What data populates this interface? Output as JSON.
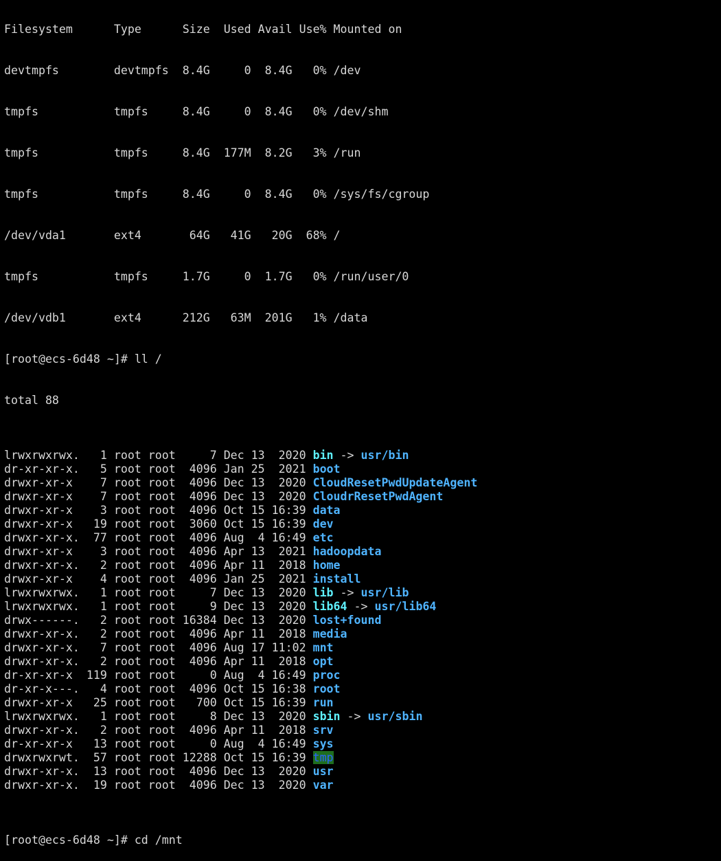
{
  "terminal": {
    "df_header": "Filesystem      Type      Size  Used Avail Use% Mounted on",
    "df_rows": [
      "devtmpfs        devtmpfs  8.4G     0  8.4G   0% /dev",
      "tmpfs           tmpfs     8.4G     0  8.4G   0% /dev/shm",
      "tmpfs           tmpfs     8.4G  177M  8.2G   3% /run",
      "tmpfs           tmpfs     8.4G     0  8.4G   0% /sys/fs/cgroup",
      "/dev/vda1       ext4       64G   41G   20G  68% /",
      "tmpfs           tmpfs     1.7G     0  1.7G   0% /run/user/0",
      "/dev/vdb1       ext4      212G   63M  201G   1% /data"
    ],
    "prompt_ll": "[root@ecs-6d48 ~]# ll /",
    "total": "total 88",
    "ls_rows": [
      {
        "prefix": "lrwxrwxrwx.   1 root root     7 Dec 13  2020 ",
        "name": "bin",
        "arrow": " -> ",
        "target": "usr/bin"
      },
      {
        "prefix": "dr-xr-xr-x.   5 root root  4096 Jan 25  2021 ",
        "name": "boot"
      },
      {
        "prefix": "drwxr-xr-x    7 root root  4096 Dec 13  2020 ",
        "name": "CloudResetPwdUpdateAgent"
      },
      {
        "prefix": "drwxr-xr-x    7 root root  4096 Dec 13  2020 ",
        "name": "CloudrResetPwdAgent"
      },
      {
        "prefix": "drwxr-xr-x    3 root root  4096 Oct 15 16:39 ",
        "name": "data"
      },
      {
        "prefix": "drwxr-xr-x   19 root root  3060 Oct 15 16:39 ",
        "name": "dev"
      },
      {
        "prefix": "drwxr-xr-x.  77 root root  4096 Aug  4 16:49 ",
        "name": "etc"
      },
      {
        "prefix": "drwxr-xr-x    3 root root  4096 Apr 13  2021 ",
        "name": "hadoopdata"
      },
      {
        "prefix": "drwxr-xr-x.   2 root root  4096 Apr 11  2018 ",
        "name": "home"
      },
      {
        "prefix": "drwxr-xr-x    4 root root  4096 Jan 25  2021 ",
        "name": "install"
      },
      {
        "prefix": "lrwxrwxrwx.   1 root root     7 Dec 13  2020 ",
        "name": "lib",
        "arrow": " -> ",
        "target": "usr/lib"
      },
      {
        "prefix": "lrwxrwxrwx.   1 root root     9 Dec 13  2020 ",
        "name": "lib64",
        "arrow": " -> ",
        "target": "usr/lib64"
      },
      {
        "prefix": "drwx------.   2 root root 16384 Dec 13  2020 ",
        "name": "lost+found"
      },
      {
        "prefix": "drwxr-xr-x.   2 root root  4096 Apr 11  2018 ",
        "name": "media"
      },
      {
        "prefix": "drwxr-xr-x.   7 root root  4096 Aug 17 11:02 ",
        "name": "mnt"
      },
      {
        "prefix": "drwxr-xr-x.   2 root root  4096 Apr 11  2018 ",
        "name": "opt"
      },
      {
        "prefix": "dr-xr-xr-x  119 root root     0 Aug  4 16:49 ",
        "name": "proc"
      },
      {
        "prefix": "dr-xr-x---.   4 root root  4096 Oct 15 16:38 ",
        "name": "root"
      },
      {
        "prefix": "drwxr-xr-x   25 root root   700 Oct 15 16:39 ",
        "name": "run"
      },
      {
        "prefix": "lrwxrwxrwx.   1 root root     8 Dec 13  2020 ",
        "name": "sbin",
        "arrow": " -> ",
        "target": "usr/sbin"
      },
      {
        "prefix": "drwxr-xr-x.   2 root root  4096 Apr 11  2018 ",
        "name": "srv"
      },
      {
        "prefix": "dr-xr-xr-x   13 root root     0 Aug  4 16:49 ",
        "name": "sys"
      },
      {
        "prefix": "drwxrwxrwt.  57 root root 12288 Oct 15 16:39 ",
        "name": "tmp",
        "sticky": true
      },
      {
        "prefix": "drwxr-xr-x.  13 root root  4096 Dec 13  2020 ",
        "name": "usr"
      },
      {
        "prefix": "drwxr-xr-x.  19 root root  4096 Dec 13  2020 ",
        "name": "var"
      }
    ],
    "prompt_cd": "[root@ecs-6d48 ~]# cd /mnt",
    "colors": {
      "background": "#000000",
      "text": "#d8d8d8",
      "directory": "#4fb4ff",
      "symlink": "#5ff2ff",
      "sticky_bg": "#1f6e1f",
      "sticky_fg": "#2b63ff"
    }
  }
}
